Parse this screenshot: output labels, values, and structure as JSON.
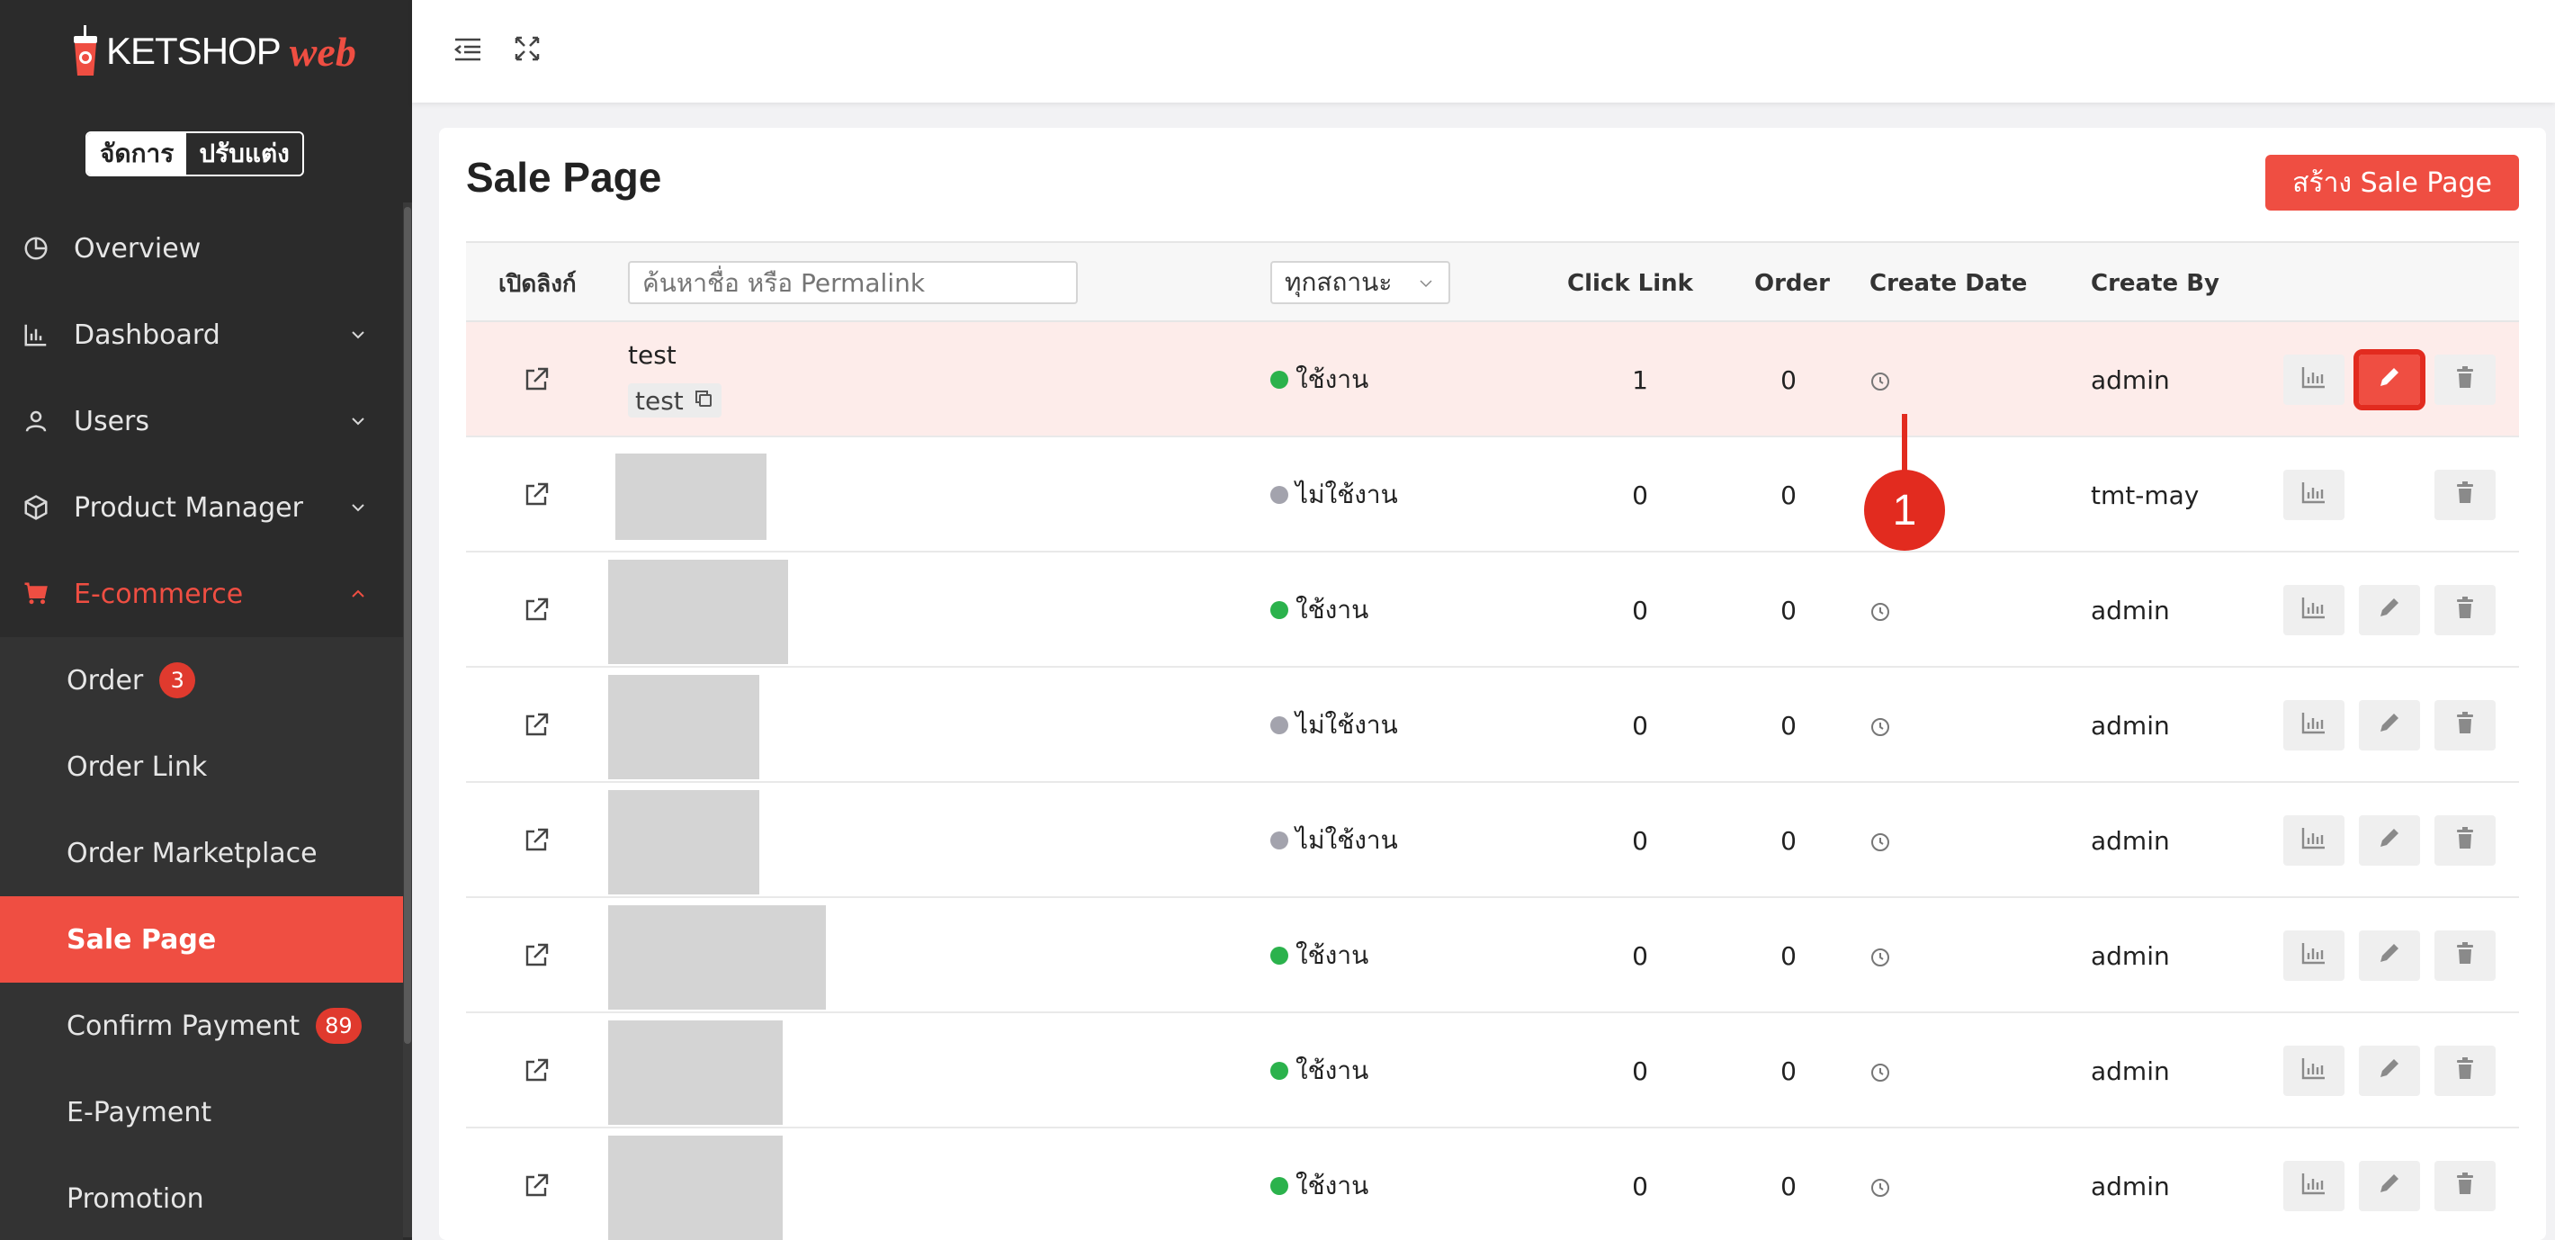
{
  "brand": {
    "name": "KETSHOP",
    "suffix": "web"
  },
  "mode_toggle": {
    "manage": "จัดการ",
    "customize": "ปรับแต่ง"
  },
  "menu": [
    {
      "label": "Overview",
      "icon": "pie-chart-icon"
    },
    {
      "label": "Dashboard",
      "icon": "bar-chart-icon"
    },
    {
      "label": "Users",
      "icon": "user-icon"
    },
    {
      "label": "Product Manager",
      "icon": "box-icon"
    },
    {
      "label": "E-commerce",
      "icon": "cart-icon"
    }
  ],
  "submenu": [
    {
      "label": "Order",
      "badge": "3"
    },
    {
      "label": "Order Link"
    },
    {
      "label": "Order Marketplace"
    },
    {
      "label": "Sale Page"
    },
    {
      "label": "Confirm Payment",
      "badge": "89"
    },
    {
      "label": "E-Payment"
    },
    {
      "label": "Promotion"
    }
  ],
  "page": {
    "title": "Sale Page",
    "create_button": "สร้าง Sale Page"
  },
  "table": {
    "headers": {
      "open_link": "เปิดลิงก์",
      "search_placeholder": "ค้นหาชื่อ หรือ Permalink",
      "status_filter": "ทุกสถานะ",
      "click_link": "Click Link",
      "order": "Order",
      "create_date": "Create Date",
      "create_by": "Create By"
    },
    "rows": [
      {
        "name": "test",
        "permalink": "test",
        "status": "ใช้งาน",
        "active": true,
        "clicks": "1",
        "orders": "0",
        "create_by": "admin"
      },
      {
        "status": "ไม่ใช้งาน",
        "active": false,
        "clicks": "0",
        "orders": "0",
        "create_by": "tmt-may"
      },
      {
        "status": "ใช้งาน",
        "active": true,
        "clicks": "0",
        "orders": "0",
        "create_by": "admin"
      },
      {
        "status": "ไม่ใช้งาน",
        "active": false,
        "clicks": "0",
        "orders": "0",
        "create_by": "admin"
      },
      {
        "status": "ไม่ใช้งาน",
        "active": false,
        "clicks": "0",
        "orders": "0",
        "create_by": "admin"
      },
      {
        "status": "ใช้งาน",
        "active": true,
        "clicks": "0",
        "orders": "0",
        "create_by": "admin"
      },
      {
        "status": "ใช้งาน",
        "active": true,
        "clicks": "0",
        "orders": "0",
        "create_by": "admin"
      },
      {
        "status": "ใช้งาน",
        "active": true,
        "clicks": "0",
        "orders": "0",
        "create_by": "admin"
      }
    ]
  },
  "annotation": {
    "label": "1"
  },
  "colors": {
    "accent": "#ef4e42",
    "active_dot": "#2bb24c",
    "inactive_dot": "#a3a3ad",
    "sidebar": "#2b2b2b"
  }
}
